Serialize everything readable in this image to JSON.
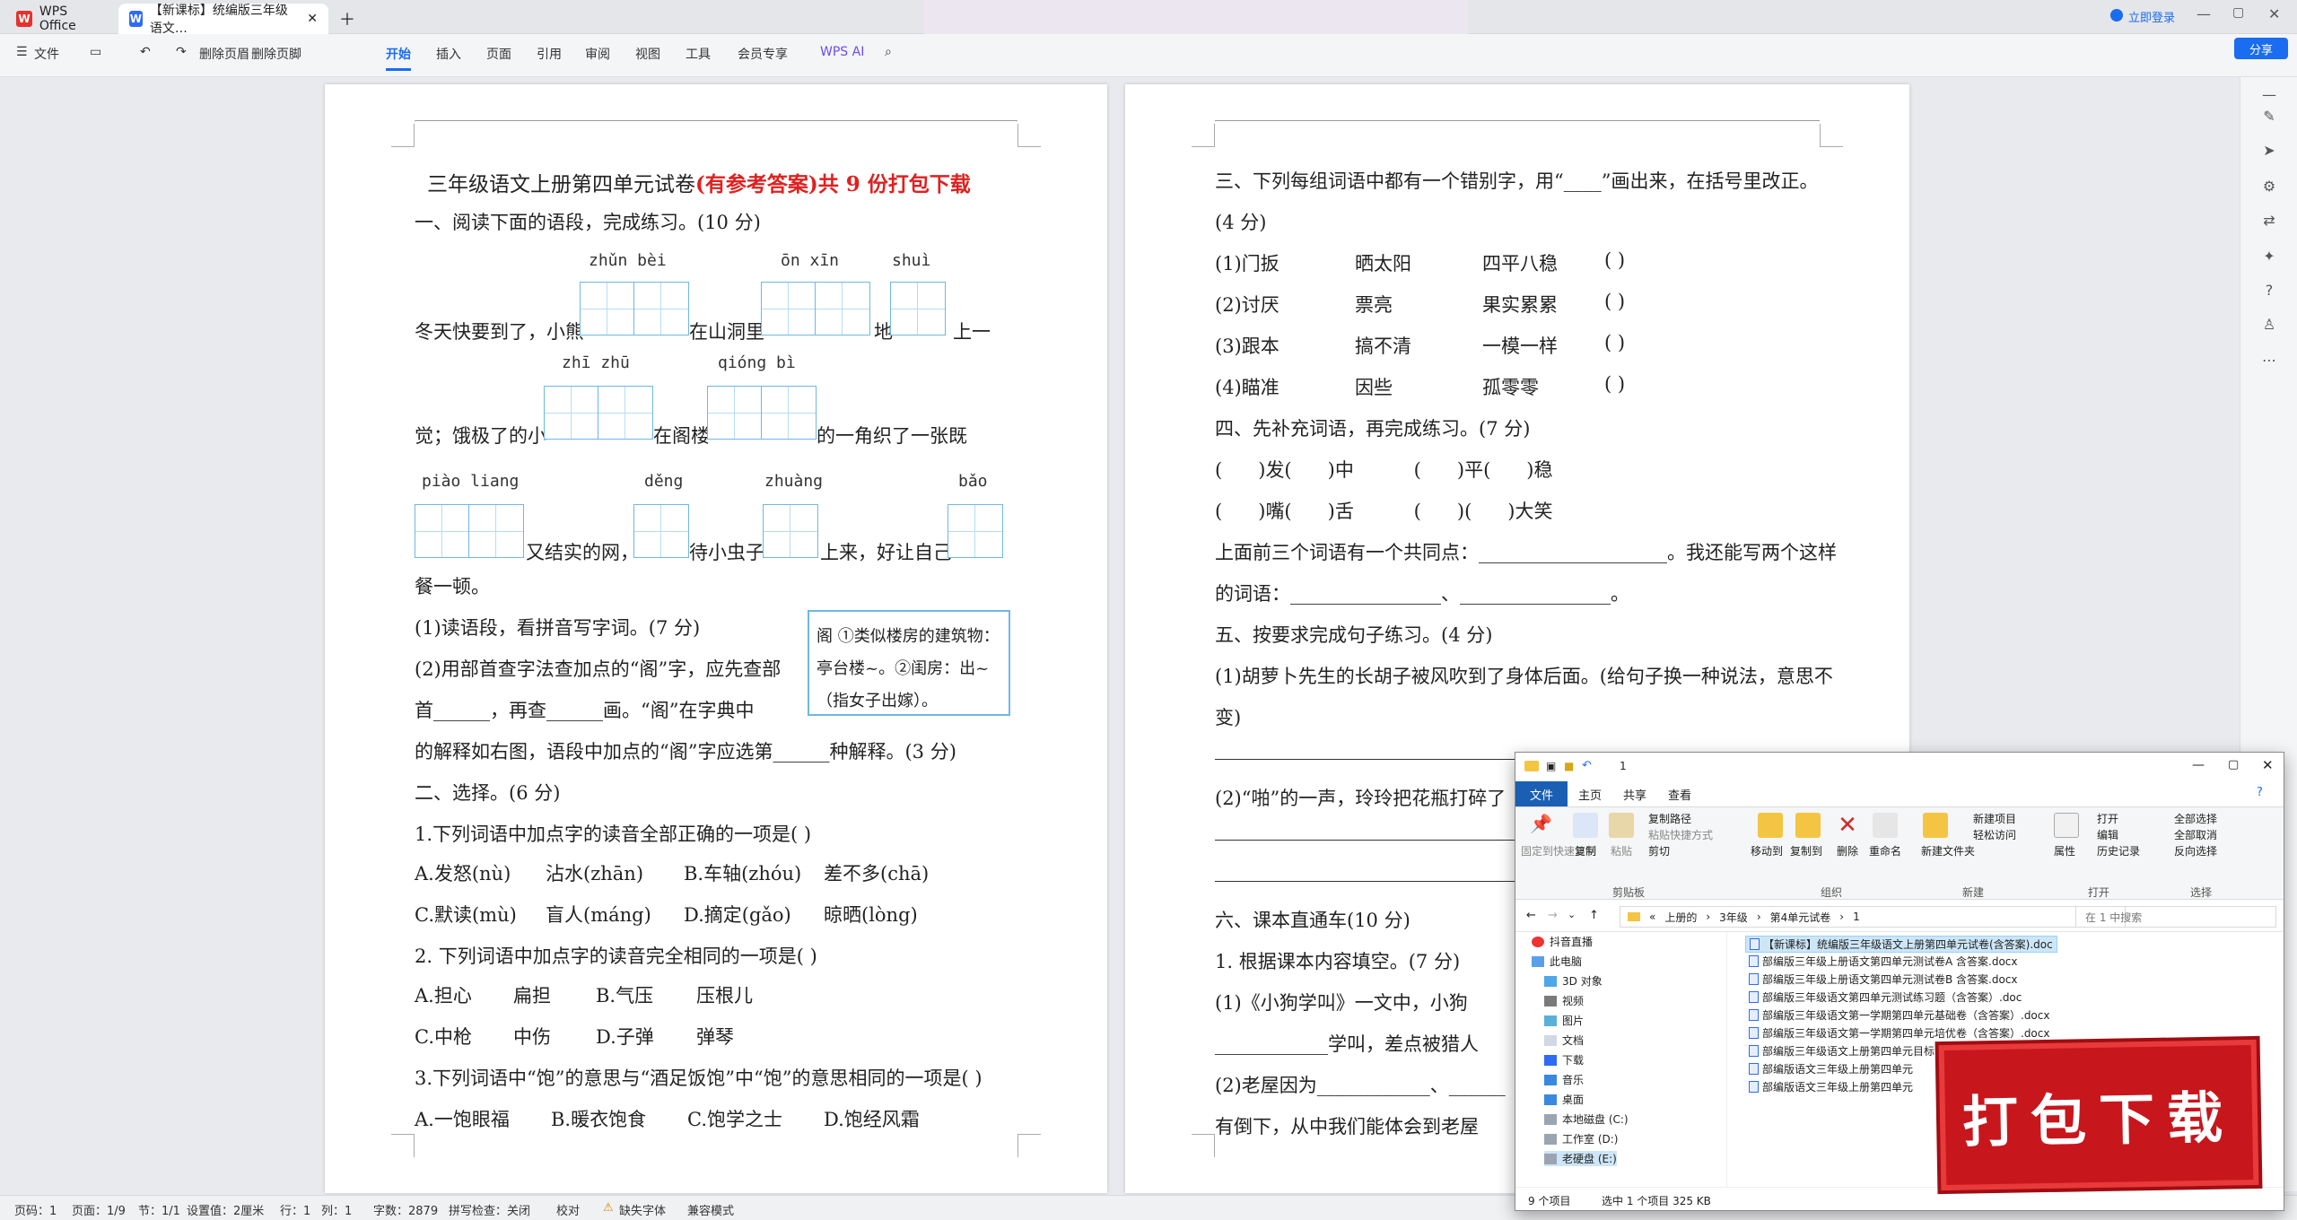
{
  "window": {
    "app_tab": "WPS Office",
    "doc_tab": "【新课标】统编版三年级语文…",
    "login": "立即登录",
    "share": "分享"
  },
  "toolbar": {
    "file": "文件",
    "delete_page": "删除页眉",
    "delete_footer": "删除页脚",
    "tabs": [
      "开始",
      "插入",
      "页面",
      "引用",
      "审阅",
      "视图",
      "工具",
      "会员专享"
    ],
    "wps_ai": "WPS AI"
  },
  "page1": {
    "title_black": "三年级语文上册第四单元试卷",
    "title_red": "(有参考答案)共 9 份打包下载",
    "s1": "一、阅读下面的语段，完成练习。(10 分)",
    "py1a": "zhǔn  bèi",
    "py1b": "ōn  xīn",
    "py1c": "shuì",
    "l1a": "冬天快要到了，小熊",
    "l1b": "在山洞里",
    "l1c": "地",
    "l1d": "上一",
    "py2a": "zhī  zhū",
    "py2b": "qióng  bì",
    "l2a": "觉；饿极了的小",
    "l2b": "在阁楼",
    "l2c": "的一角织了一张既",
    "py3a": "piào  liang",
    "py3b": "děng",
    "py3c": "zhuàng",
    "py3d": "bǎo",
    "l3a": "又结实的网，",
    "l3b": "待小虫子",
    "l3c": "上来，好让自己",
    "l4": "餐一顿。",
    "q1": "(1)读语段，看拼音写字词。(7 分)",
    "q2a": "(2)用部首查字法查加点的“阁”字，应先查部",
    "q2b": "首______，再查______画。“阁”在字典中",
    "q2c": "的解释如右图，语段中加点的“阁”字应选第______种解释。(3 分)",
    "dict": "阁  ①类似楼房的建筑物：亭台楼~。②闺房：出~（指女子出嫁）。",
    "s2": "二、选择。(6 分)",
    "c1": "1.下列词语中加点字的读音全部正确的一项是(      )",
    "c1a": "A.发怒(nù)",
    "c1a2": "沾水(zhān)",
    "c1b": "B.车轴(zhóu)",
    "c1b2": "差不多(chā)",
    "c1c": "C.默读(mù)",
    "c1c2": "盲人(máng)",
    "c1d": "D.摘定(gǎo)",
    "c1d2": "晾晒(lòng)",
    "c2": "2. 下列词语中加点字的读音完全相同的一项是(      )",
    "c2a": "A.担心",
    "c2a2": "扁担",
    "c2b": "B.气压",
    "c2b2": "压根儿",
    "c2c": "C.中枪",
    "c2c2": "中伤",
    "c2d": "D.子弹",
    "c2d2": "弹琴",
    "c3": "3.下列词语中“饱”的意思与“酒足饭饱”中“饱”的意思相同的一项是(      )",
    "c3a": "A.一饱眼福",
    "c3b": "B.暖衣饱食",
    "c3c": "C.饱学之士",
    "c3d": "D.饱经风霜"
  },
  "page2": {
    "s3": "三、下列每组词语中都有一个错别字，用“____”画出来，在括号里改正。",
    "s3b": "(4 分)",
    "r1": [
      "(1)门扳",
      "晒太阳",
      "四平八稳",
      "(      )"
    ],
    "r2": [
      "(2)讨厌",
      "票亮",
      "果实累累",
      "(      )"
    ],
    "r3": [
      "(3)跟本",
      "搞不清",
      "一模一样",
      "(      )"
    ],
    "r4": [
      "(4)瞄准",
      "因些",
      "孤零零",
      "(      )"
    ],
    "s4": "四、先补充词语，再完成练习。(7 分)",
    "w1": "(      )发(      )中          (      )平(      )稳",
    "w2": "(      )嘴(      )舌          (      )(      )大笑",
    "w3": "上面前三个词语有一个共同点：____________________。我还能写两个这样",
    "w4": "的词语：________________、________________。",
    "s5": "五、按要求完成句子练习。(4 分)",
    "j1": "(1)胡萝卜先生的长胡子被风吹到了身体后面。(给句子换一种说法，意思不",
    "j1b": "变)",
    "j2": "(2)“啪”的一声，玲玲把花瓶打碎了",
    "s6": "六、课本直通车(10 分)",
    "k1": "1. 根据课本内容填空。(7 分)",
    "k2": "(1)《小狗学叫》一文中，小狗",
    "k3": "____________学叫，差点被猎人",
    "k4": "(2)老屋因为____________、______",
    "k5": "有倒下，从中我们能体会到老屋"
  },
  "status": {
    "page": "页码：1",
    "pages": "页面：1/9",
    "section": "节：1/1",
    "setting": "设置值：2厘米",
    "row": "行：1",
    "col": "列：1",
    "words": "字数：2879",
    "spell": "拼写检查：关闭",
    "proof": "校对",
    "missing_font": "缺失字体",
    "compat": "兼容模式"
  },
  "explorer": {
    "title": "1",
    "tabs": [
      "文件",
      "主页",
      "共享",
      "查看"
    ],
    "ribbon": {
      "pin": "固定到快速访问",
      "copy": "复制",
      "paste": "粘贴",
      "copy_path": "复制路径",
      "paste_shortcut": "粘贴快捷方式",
      "cut": "剪切",
      "clipboard": "剪贴板",
      "move_to": "移动到",
      "copy_to": "复制到",
      "delete": "删除",
      "rename": "重命名",
      "organize": "组织",
      "new_folder": "新建文件夹",
      "new_item": "新建项目",
      "easy_access": "轻松访问",
      "new": "新建",
      "properties": "属性",
      "open": "打开",
      "edit": "编辑",
      "history": "历史记录",
      "open_grp": "打开",
      "select_all": "全部选择",
      "select_none": "全部取消",
      "invert": "反向选择",
      "select_grp": "选择"
    },
    "path": [
      "上册的",
      "3年级",
      "第4单元试卷",
      "1"
    ],
    "search": "在 1 中搜索",
    "nav": [
      "抖音直播",
      "此电脑",
      "3D 对象",
      "视频",
      "图片",
      "文档",
      "下载",
      "音乐",
      "桌面",
      "本地磁盘 (C:)",
      "工作室 (D:)",
      "老硬盘 (E:)"
    ],
    "files": [
      "【新课标】统编版三年级语文上册第四单元试卷(含答案).doc",
      "部编版三年级上册语文第四单元测试卷A  含答案.docx",
      "部编版三年级上册语文第四单元测试卷B  含答案.docx",
      "部编版三年级语文第四单元测试练习题（含答案）.doc",
      "部编版三年级语文第一学期第四单元基础卷（含答案）.docx",
      "部编版三年级语文第一学期第四单元培优卷（含答案）.docx",
      "部编版三年级语文上册第四单元目标阅读练",
      "部编版语文三年级上册第四单元",
      "部编版语文三年级上册第四单元"
    ],
    "status_items": "9 个项目",
    "status_sel": "选中 1 个项目  325 KB"
  },
  "badge": "打包下载"
}
